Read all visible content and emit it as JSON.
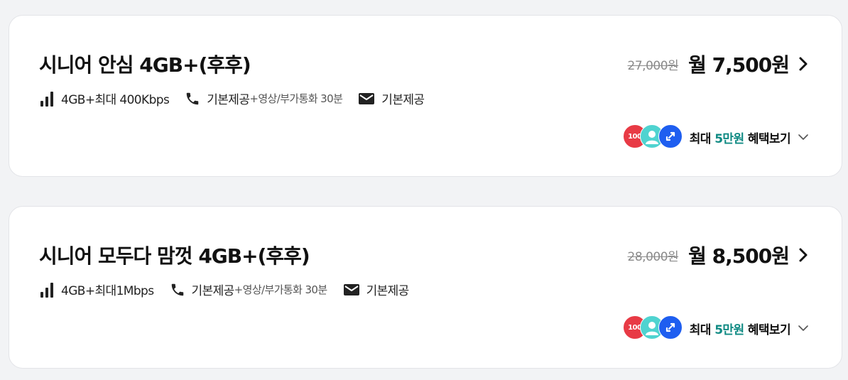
{
  "plans": [
    {
      "title": "시니어 안심 4GB+(후후)",
      "original_price": "27,000원",
      "price": "월 7,500원",
      "data_spec": "4GB+최대 400Kbps",
      "voice_spec": "기본제공",
      "voice_extra": "+영상/부가통화 30분",
      "sms_spec": "기본제공",
      "badge_label": "100",
      "benefit_prefix": "최대 ",
      "benefit_amount": "5만원",
      "benefit_suffix": " 혜택보기"
    },
    {
      "title": "시니어 모두다 맘껏 4GB+(후후)",
      "original_price": "28,000원",
      "price": "월 8,500원",
      "data_spec": "4GB+최대1Mbps",
      "voice_spec": "기본제공",
      "voice_extra": "+영상/부가통화 30분",
      "sms_spec": "기본제공",
      "badge_label": "100",
      "benefit_prefix": "최대 ",
      "benefit_amount": "5만원",
      "benefit_suffix": " 혜택보기"
    }
  ],
  "icons": {
    "data": "signal-bars-icon",
    "voice": "phone-icon",
    "sms": "mail-icon",
    "price_arrow": "chevron-right-icon",
    "benefit_toggle": "chevron-down-icon"
  },
  "colors": {
    "accent_teal": "#0f8a83",
    "badge_red": "#e83a45",
    "badge_cyan": "#4fd3d0",
    "badge_blue": "#1e5ef0"
  }
}
